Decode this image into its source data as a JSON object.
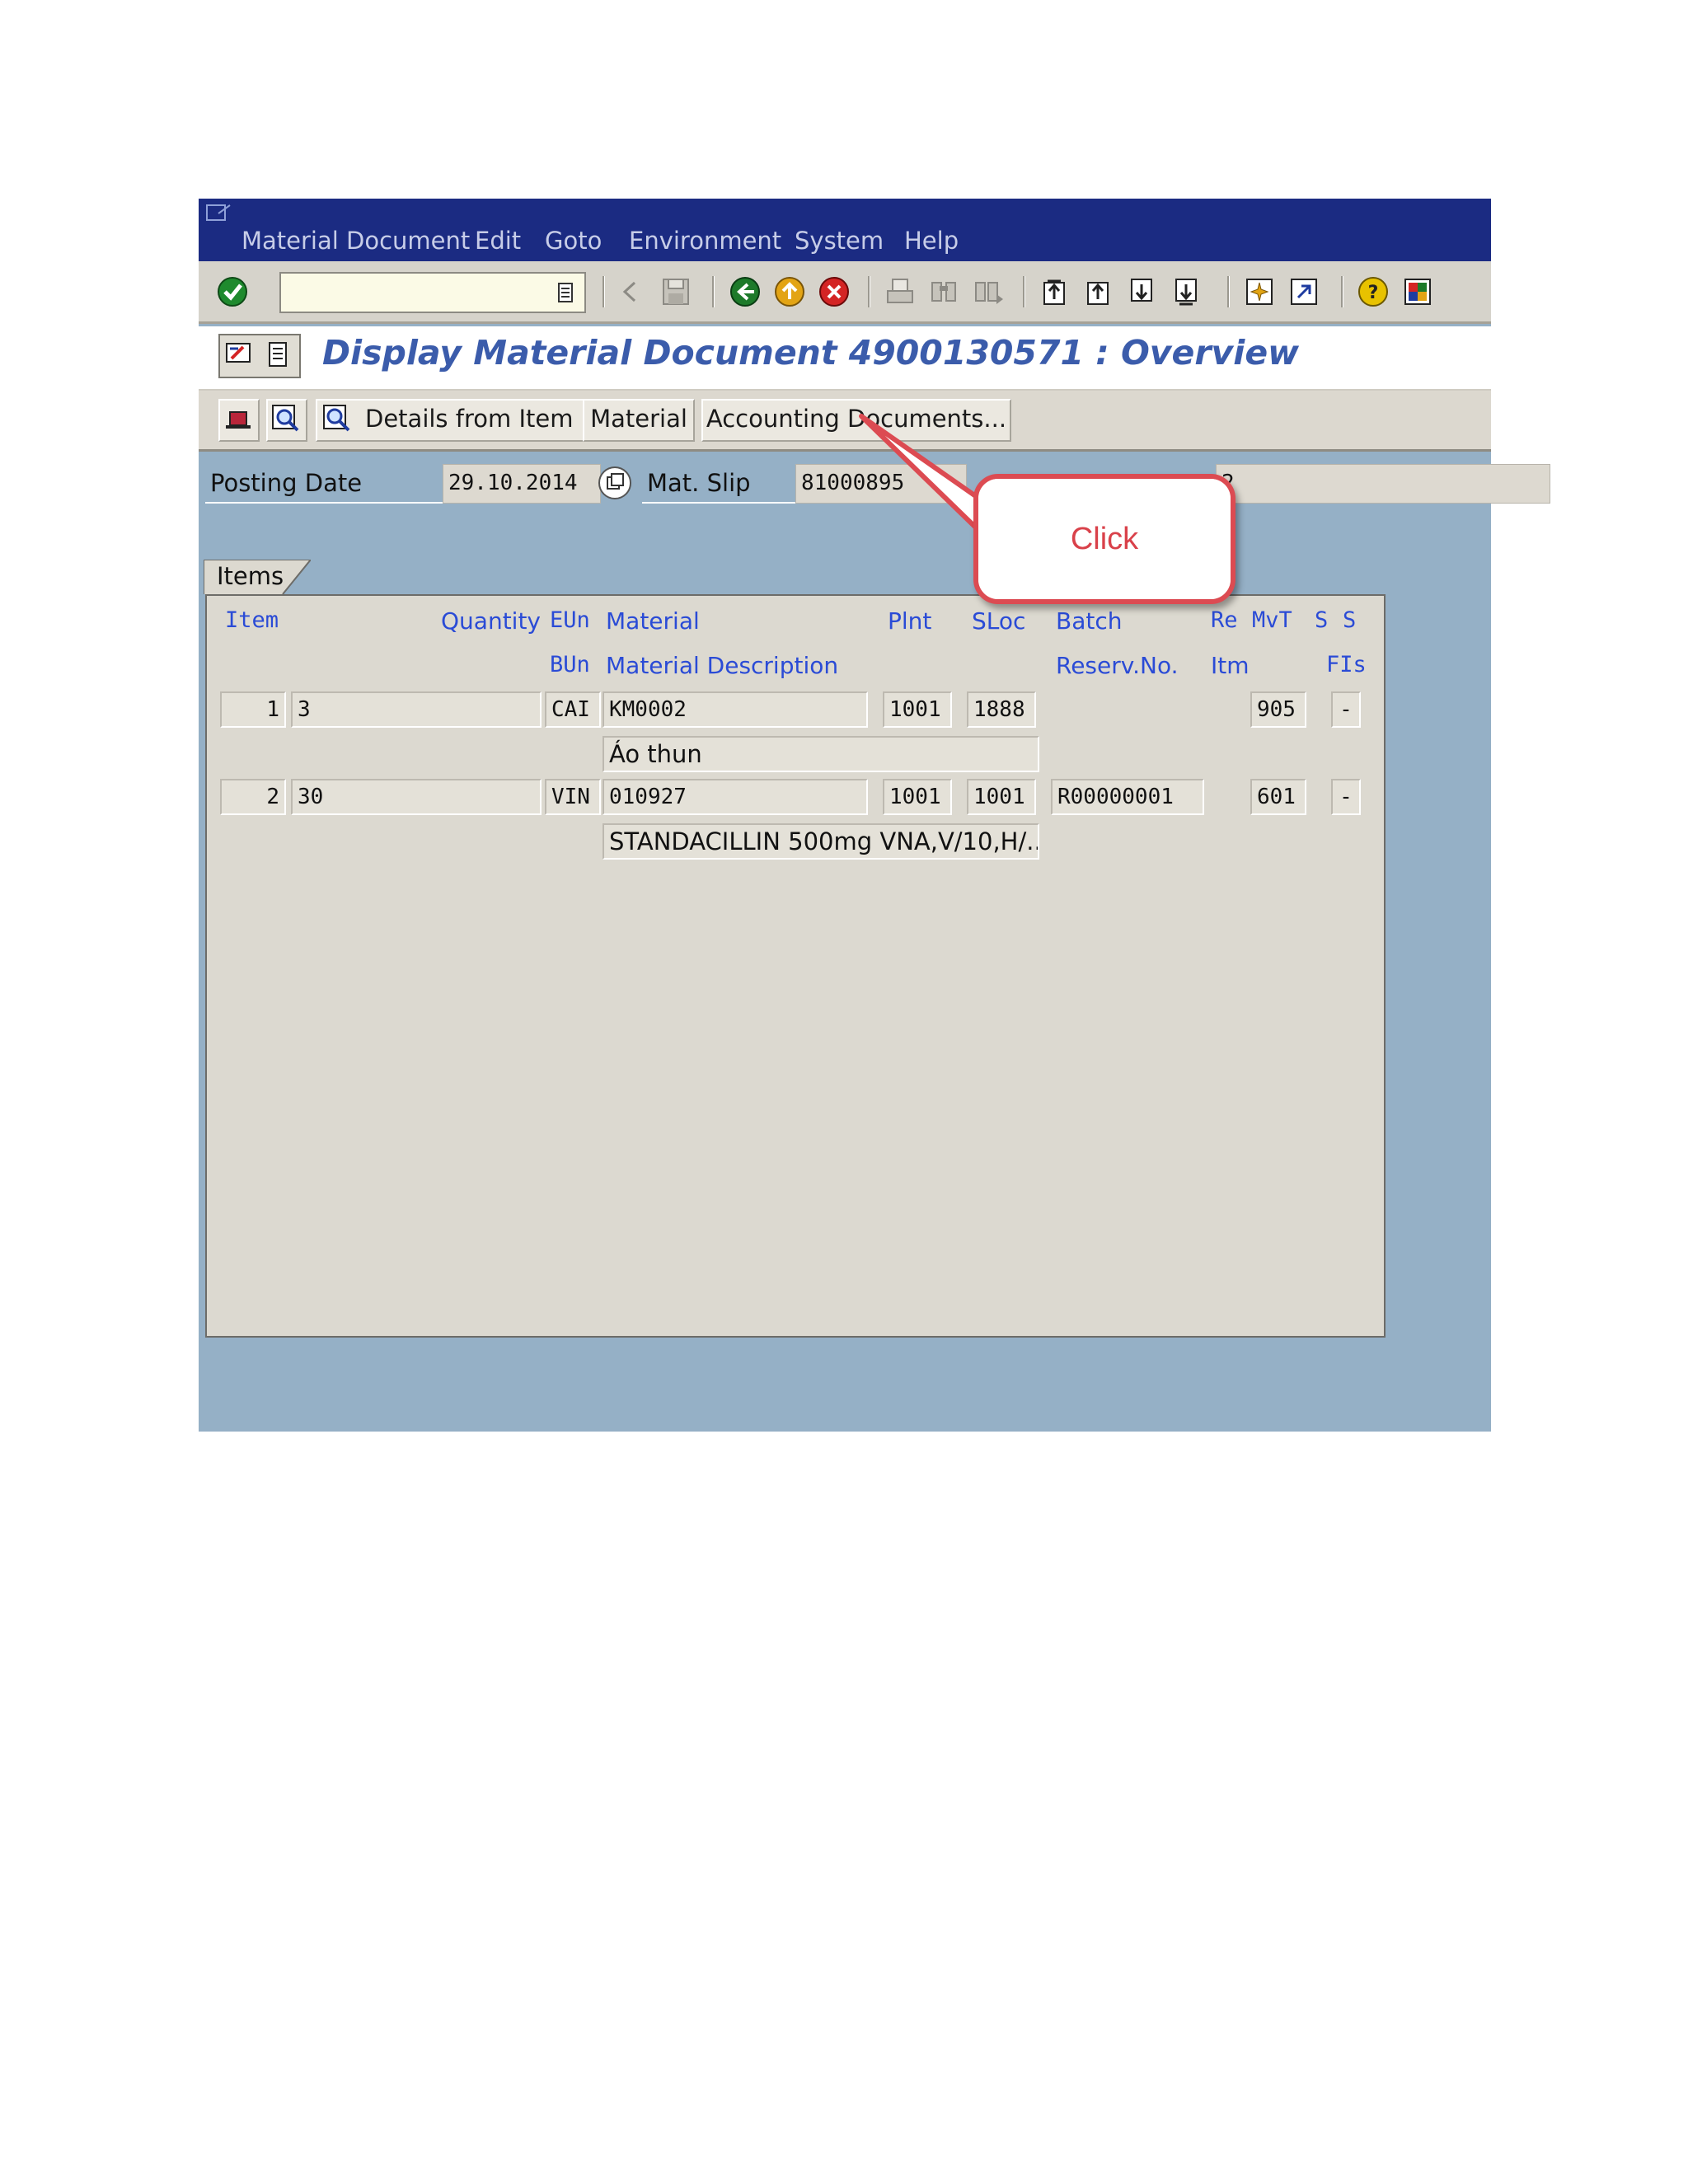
{
  "menu": {
    "items": [
      {
        "label": "Material Document",
        "mnemonic": "M"
      },
      {
        "label": "Edit",
        "mnemonic": "E"
      },
      {
        "label": "Goto",
        "mnemonic": "G"
      },
      {
        "label": "Environment",
        "mnemonic": "v"
      },
      {
        "label": "System",
        "mnemonic": "y"
      },
      {
        "label": "Help",
        "mnemonic": "H"
      }
    ]
  },
  "toolbar": {
    "command_field_value": "",
    "icons": [
      "enter-icon",
      "back-arrow-icon",
      "save-icon",
      "back-icon",
      "exit-icon",
      "cancel-icon",
      "print-icon",
      "find-icon",
      "find-next-icon",
      "first-page-icon",
      "previous-page-icon",
      "next-page-icon",
      "last-page-icon",
      "create-session-icon",
      "shortcut-icon",
      "help-icon",
      "layout-icon"
    ]
  },
  "title": {
    "text": "Display Material Document 4900130571 : Overview"
  },
  "app_toolbar": {
    "details_from_item": "Details from Item",
    "material": "Material",
    "accounting_documents": "Accounting Documents..."
  },
  "header": {
    "posting_date_label": "Posting Date",
    "posting_date_value": "29.10.2014",
    "mat_slip_label": "Mat. Slip",
    "mat_slip_value": "81000895",
    "partial_value": "2"
  },
  "items": {
    "tab_label": "Items",
    "headers_row1": {
      "item": "Item",
      "quantity": "Quantity",
      "eun": "EUn",
      "material": "Material",
      "plnt": "Plnt",
      "sloc": "SLoc",
      "batch": "Batch",
      "re": "Re",
      "mvt": "MvT",
      "s1": "S",
      "s2": "S"
    },
    "headers_row2": {
      "bun": "BUn",
      "material_description": "Material Description",
      "reserv_no": "Reserv.No.",
      "itm": "Itm",
      "fis": "FIs"
    },
    "rows": [
      {
        "item": "1",
        "quantity": "3",
        "eun": "CAI",
        "material": "KM0002",
        "description": "Áo thun",
        "plnt": "1001",
        "sloc": "1888",
        "batch": "",
        "mvt": "905",
        "s": "-"
      },
      {
        "item": "2",
        "quantity": "30",
        "eun": "VIN",
        "material": "010927",
        "description": "STANDACILLIN 500mg VNA,V/10,H/...",
        "plnt": "1001",
        "sloc": "1001",
        "batch": "R00000001",
        "mvt": "601",
        "s": "-"
      }
    ]
  },
  "callout": {
    "text": "Click",
    "color": "#dc4b52"
  }
}
